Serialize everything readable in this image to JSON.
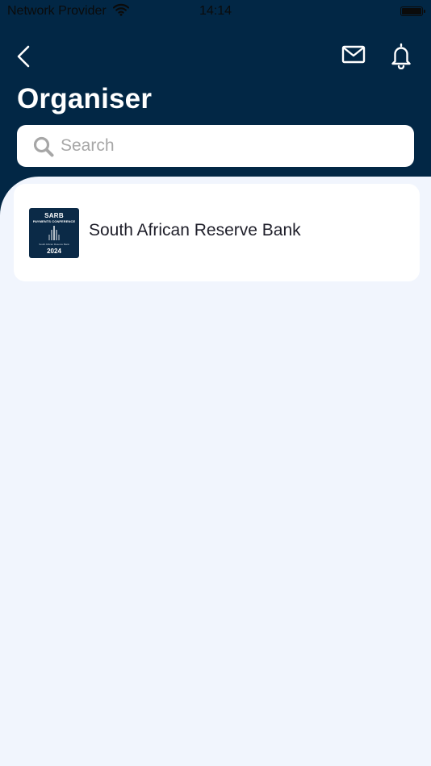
{
  "status_bar": {
    "carrier": "Network Provider",
    "time": "14:14",
    "icons": [
      "wifi-icon",
      "battery-icon"
    ]
  },
  "header": {
    "title": "Organiser",
    "background_color": "#022745",
    "icons": [
      "chevron-left-icon",
      "mail-icon",
      "bell-icon"
    ]
  },
  "search": {
    "placeholder": "Search",
    "value": "",
    "icon": "search-icon"
  },
  "organisers": [
    {
      "name": "South African Reserve Bank",
      "logo": {
        "line1": "SARB",
        "line2": "PAYMENTS CONFERENCE",
        "line3": "South African Reserve Bank",
        "line4": "2024"
      }
    }
  ],
  "colors": {
    "page_background": "#f1f5fd",
    "card_background": "#ffffff",
    "title_text": "#ffffff",
    "placeholder_text": "#a7a7a7"
  }
}
